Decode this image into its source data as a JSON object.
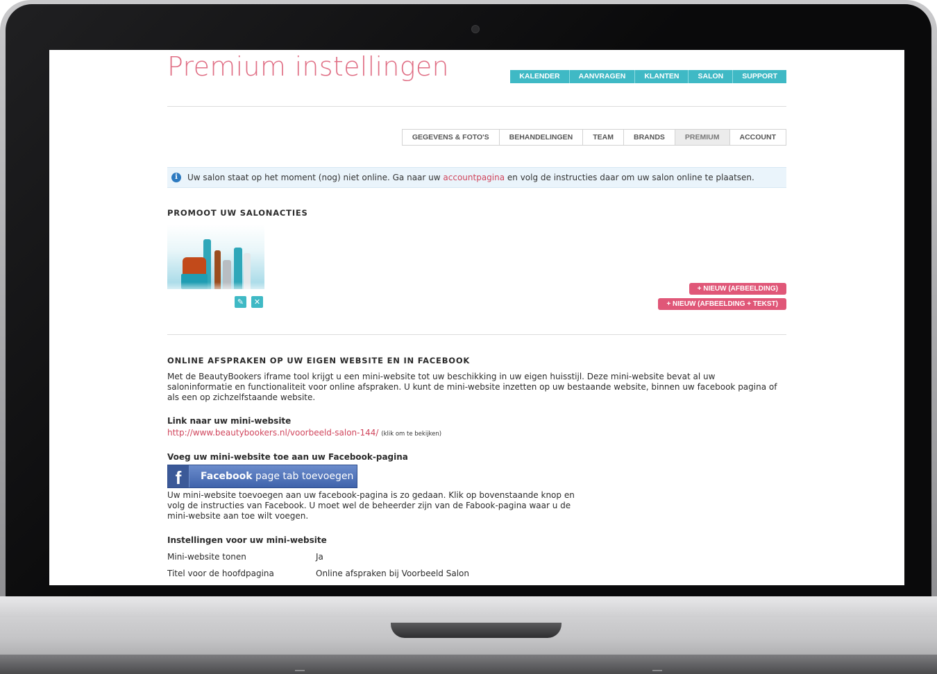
{
  "page": {
    "title": "Premium instellingen"
  },
  "top_nav": [
    {
      "label": "KALENDER"
    },
    {
      "label": "AANVRAGEN"
    },
    {
      "label": "KLANTEN"
    },
    {
      "label": "SALON"
    },
    {
      "label": "SUPPORT"
    }
  ],
  "sub_tabs": [
    {
      "label": "GEGEVENS & FOTO'S"
    },
    {
      "label": "BEHANDELINGEN"
    },
    {
      "label": "TEAM"
    },
    {
      "label": "BRANDS"
    },
    {
      "label": "PREMIUM",
      "active": true
    },
    {
      "label": "ACCOUNT"
    }
  ],
  "notice": {
    "icon": "info-icon",
    "text_before": "Uw salon staat op het moment (nog) niet online. Ga naar uw ",
    "link_text": "accountpagina",
    "text_after": " en volg de instructies daar om uw salon online te plaatsen."
  },
  "promo": {
    "heading": "PROMOOT UW SALONACTIES",
    "edit_icon": "pencil-icon",
    "delete_icon": "close-icon",
    "new_image_button": "+ NIEUW (AFBEELDING)",
    "new_image_text_button": "+ NIEUW (AFBEELDING + TEKST)"
  },
  "online": {
    "heading": "ONLINE AFSPRAKEN OP UW EIGEN WEBSITE EN IN FACEBOOK",
    "intro_lines": [
      "Met de BeautyBookers iframe tool krijgt u een mini-website tot uw beschikking in uw eigen huisstijl. Deze mini-website bevat al uw",
      "saloninformatie en functionaliteit voor online afspraken. U kunt de mini-website inzetten op uw bestaande website, binnen uw facebook pagina of",
      "als een op zichzelfstaande website."
    ],
    "link_heading": "Link naar uw mini-website",
    "link_url": "http://www.beautybookers.nl/voorbeeld-salon-144/",
    "link_note": "(klik om te bekijken)",
    "facebook_heading": "Voeg uw mini-website toe aan uw Facebook-pagina",
    "facebook_button_bold": "Facebook",
    "facebook_button_rest": " page tab toevoegen",
    "facebook_lines": [
      "Uw mini-website toevoegen aan uw facebook-pagina is zo gedaan. Klik op bovenstaande knop en",
      "volg de instructies van Facebook. U moet wel de beheerder zijn van de Fabook-pagina waar u de",
      "mini-website aan toe wilt voegen."
    ],
    "settings_heading": "Instellingen voor uw mini-website",
    "settings": [
      {
        "label": "Mini-website tonen",
        "value": "Ja"
      },
      {
        "label": "Titel voor de hoofdpagina",
        "value": "Online afspraken bij Voorbeeld Salon"
      }
    ]
  }
}
